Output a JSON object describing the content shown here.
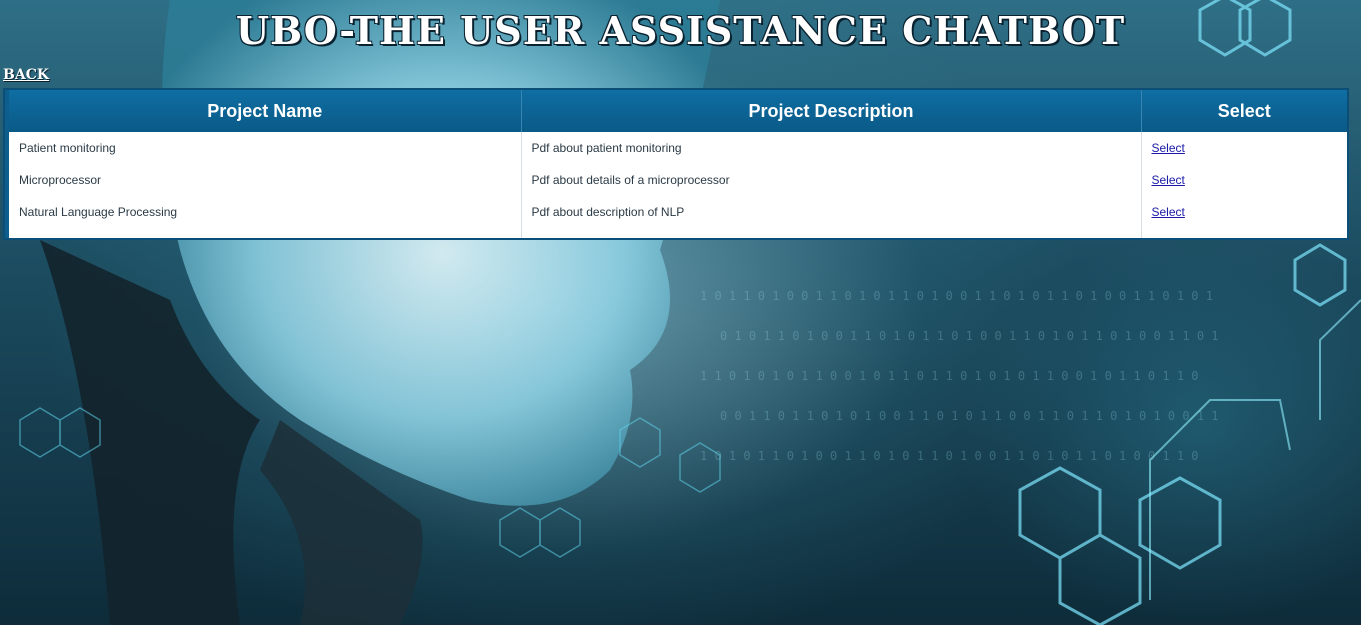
{
  "header": {
    "title": "UBO-THE USER ASSISTANCE CHATBOT",
    "back_label": "BACK"
  },
  "table": {
    "columns": [
      "Project Name",
      "Project Description",
      "Select"
    ],
    "rows": [
      {
        "name": "Patient monitoring",
        "description": "Pdf about patient monitoring",
        "action": "Select"
      },
      {
        "name": "Microprocessor",
        "description": "Pdf about details of a microprocessor",
        "action": "Select"
      },
      {
        "name": "Natural Language Processing",
        "description": "Pdf about description of NLP",
        "action": "Select"
      }
    ]
  },
  "colors": {
    "header_bg": "#0d5e8c",
    "link": "#1a1aa8"
  }
}
